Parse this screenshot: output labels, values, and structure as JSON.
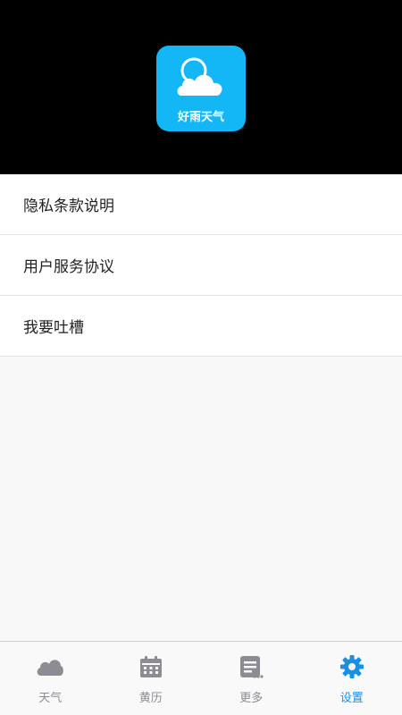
{
  "app": {
    "name": "好雨天气",
    "icon": "cloud-sun-icon",
    "accent_color": "#14b7f6"
  },
  "menu": {
    "items": [
      {
        "label": "隐私条款说明"
      },
      {
        "label": "用户服务协议"
      },
      {
        "label": "我要吐槽"
      }
    ]
  },
  "tabbar": {
    "active_color": "#1b8fe0",
    "inactive_color": "#8c8c92",
    "tabs": [
      {
        "label": "天气",
        "icon": "cloud-icon",
        "active": false
      },
      {
        "label": "黄历",
        "icon": "calendar-icon",
        "active": false
      },
      {
        "label": "更多",
        "icon": "list-more-icon",
        "active": false
      },
      {
        "label": "设置",
        "icon": "gear-icon",
        "active": true
      }
    ]
  }
}
